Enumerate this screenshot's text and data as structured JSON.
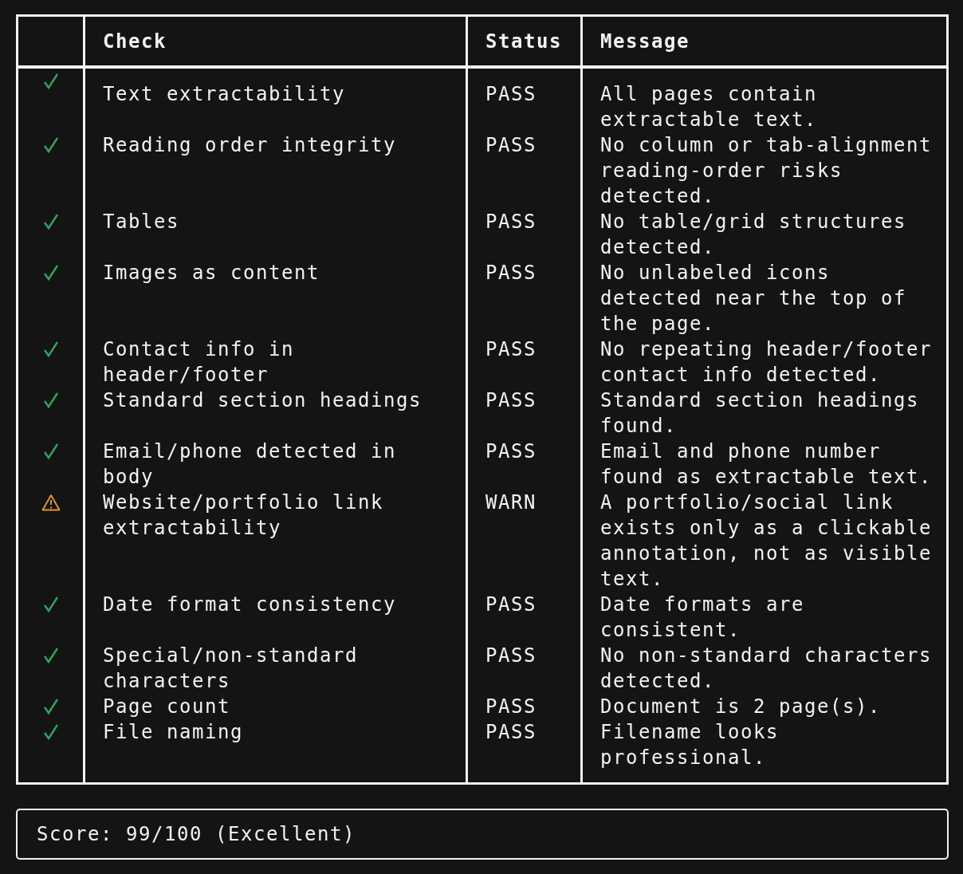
{
  "table": {
    "columns": [
      "Check",
      "Status",
      "Message"
    ],
    "rows": [
      {
        "kind": "pass",
        "check": "Text extractability",
        "status": "PASS",
        "message": "All pages contain extractable text."
      },
      {
        "kind": "pass",
        "check": "Reading order integrity",
        "status": "PASS",
        "message": "No column or tab-alignment reading-order risks detected."
      },
      {
        "kind": "pass",
        "check": "Tables",
        "status": "PASS",
        "message": "No table/grid structures detected."
      },
      {
        "kind": "pass",
        "check": "Images as content",
        "status": "PASS",
        "message": "No unlabeled icons detected near the top of the page."
      },
      {
        "kind": "pass",
        "check": "Contact info in header/footer",
        "status": "PASS",
        "message": "No repeating header/footer contact info detected."
      },
      {
        "kind": "pass",
        "check": "Standard section headings",
        "status": "PASS",
        "message": "Standard section headings found."
      },
      {
        "kind": "pass",
        "check": "Email/phone detected in body",
        "status": "PASS",
        "message": "Email and phone number found as extractable text."
      },
      {
        "kind": "warn",
        "check": "Website/portfolio link extractability",
        "status": "WARN",
        "message": "A portfolio/social link exists only as a clickable annotation, not as visible text."
      },
      {
        "kind": "pass",
        "check": "Date format consistency",
        "status": "PASS",
        "message": "Date formats are consistent."
      },
      {
        "kind": "pass",
        "check": "Special/non-standard characters",
        "status": "PASS",
        "message": "No non-standard characters detected."
      },
      {
        "kind": "pass",
        "check": "Page count",
        "status": "PASS",
        "message": "Document is 2 page(s)."
      },
      {
        "kind": "pass",
        "check": "File naming",
        "status": "PASS",
        "message": "Filename looks professional."
      }
    ]
  },
  "score": "Score: 99/100 (Excellent)"
}
